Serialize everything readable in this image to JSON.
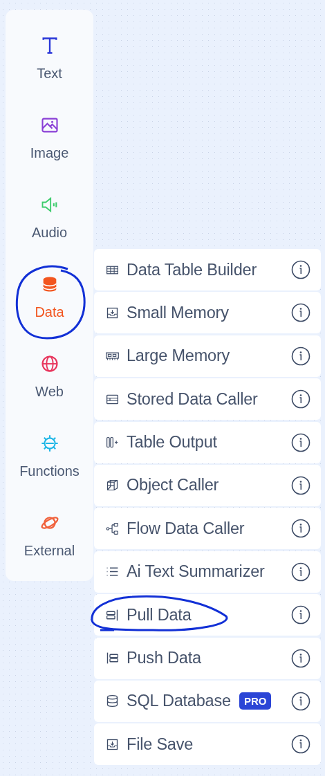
{
  "sidebar": {
    "items": [
      {
        "label": "Text",
        "selected": false,
        "color": "#2936d8",
        "circled": false
      },
      {
        "label": "Image",
        "selected": false,
        "color": "#8a3fd6",
        "circled": false
      },
      {
        "label": "Audio",
        "selected": false,
        "color": "#3dcc6c",
        "circled": false
      },
      {
        "label": "Data",
        "selected": true,
        "color": "#f2551f",
        "circled": true
      },
      {
        "label": "Web",
        "selected": false,
        "color": "#e8345c",
        "circled": false
      },
      {
        "label": "Functions",
        "selected": false,
        "color": "#1fb6e6",
        "circled": false
      },
      {
        "label": "External",
        "selected": false,
        "color": "#f0613c",
        "circled": false
      }
    ]
  },
  "menu": {
    "items": [
      {
        "label": "Data Table Builder",
        "circled": false
      },
      {
        "label": "Small Memory",
        "circled": false
      },
      {
        "label": "Large Memory",
        "circled": false
      },
      {
        "label": "Stored Data Caller",
        "circled": false
      },
      {
        "label": "Table Output",
        "circled": false
      },
      {
        "label": "Object Caller",
        "circled": false
      },
      {
        "label": "Flow Data Caller",
        "circled": false
      },
      {
        "label": "Ai Text Summarizer",
        "circled": false
      },
      {
        "label": "Pull Data",
        "circled": true
      },
      {
        "label": "Push Data",
        "circled": false
      },
      {
        "label": "SQL Database",
        "badge": "PRO",
        "circled": false
      },
      {
        "label": "File Save",
        "circled": false
      }
    ]
  }
}
